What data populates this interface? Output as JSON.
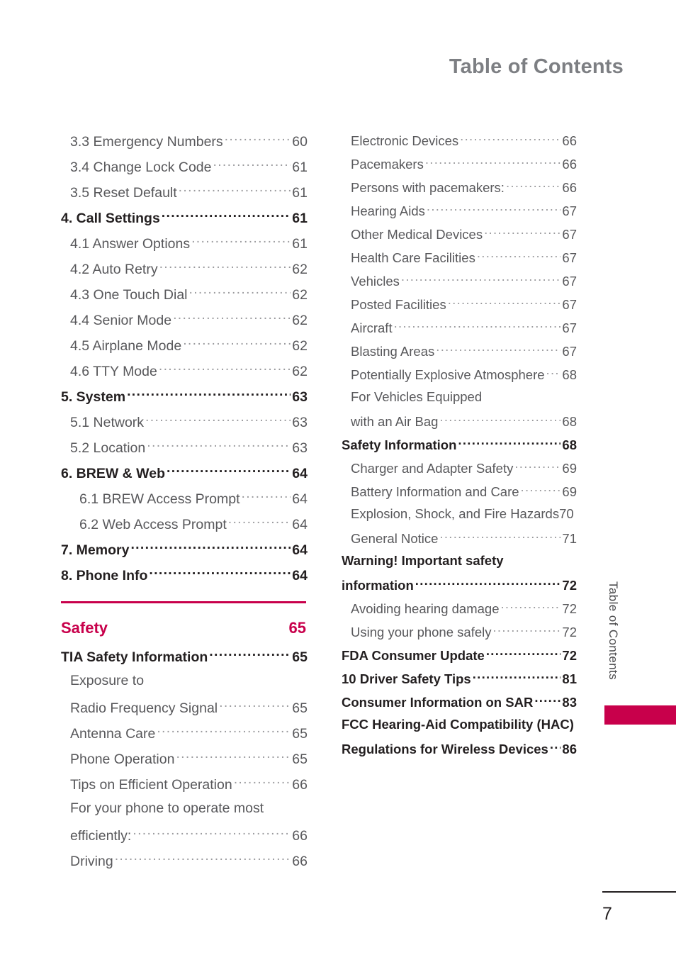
{
  "header": {
    "title": "Table of Contents"
  },
  "side_tab": {
    "label": "Table of Contents",
    "marker_color": "#c8004b"
  },
  "footer": {
    "page_number": "7"
  },
  "theme": {
    "accent": "#c8004b",
    "heading_gray": "#7d7f83",
    "body_gray": "#58585b",
    "bold_black": "#231f20"
  },
  "columns": {
    "left": {
      "rows": [
        {
          "title": "3.3 Emergency Numbers",
          "page": "60",
          "level": 2
        },
        {
          "title": "3.4 Change Lock Code",
          "page": "61",
          "level": 2
        },
        {
          "title": "3.5 Reset Default",
          "page": "61",
          "level": 2
        },
        {
          "title": "4. Call Settings",
          "page": "61",
          "level": 1
        },
        {
          "title": "4.1 Answer Options",
          "page": "61",
          "level": 2
        },
        {
          "title": "4.2 Auto Retry",
          "page": "62",
          "level": 2
        },
        {
          "title": "4.3 One Touch Dial",
          "page": "62",
          "level": 2
        },
        {
          "title": "4.4 Senior Mode",
          "page": "62",
          "level": 2
        },
        {
          "title": "4.5 Airplane Mode",
          "page": "62",
          "level": 2
        },
        {
          "title": "4.6 TTY Mode",
          "page": "62",
          "level": 2
        },
        {
          "title": "5. System",
          "page": "63",
          "level": 1
        },
        {
          "title": "5.1 Network",
          "page": "63",
          "level": 2
        },
        {
          "title": "5.2 Location",
          "page": "63",
          "level": 2
        },
        {
          "title": "6. BREW & Web",
          "page": "64",
          "level": 1
        },
        {
          "title": "6.1 BREW Access Prompt",
          "page": "64",
          "level": 3
        },
        {
          "title": "6.2 Web Access Prompt",
          "page": "64",
          "level": 3
        },
        {
          "title": "7. Memory",
          "page": "64",
          "level": 1
        },
        {
          "title": "8. Phone Info",
          "page": "64",
          "level": 1
        }
      ],
      "section": {
        "title": "Safety",
        "page": "65"
      },
      "rows_after_section": [
        {
          "title": "TIA Safety Information",
          "page": "65",
          "level": 1
        },
        {
          "title": "Exposure to",
          "page": "",
          "level": 2,
          "no_page": true
        },
        {
          "title": "Radio Frequency Signal",
          "page": "65",
          "level": 2
        },
        {
          "title": "Antenna Care",
          "page": "65",
          "level": 2
        },
        {
          "title": "Phone Operation",
          "page": "65",
          "level": 2
        },
        {
          "title": "Tips on Efficient Operation",
          "page": "66",
          "level": 2
        },
        {
          "title": "For your phone to operate most",
          "page": "",
          "level": 2,
          "no_page": true
        },
        {
          "title": "efficiently:",
          "page": "66",
          "level": 2
        },
        {
          "title": "Driving",
          "page": "66",
          "level": 2
        }
      ]
    },
    "right": {
      "rows": [
        {
          "title": "Electronic Devices",
          "page": "66",
          "level": 2
        },
        {
          "title": "Pacemakers",
          "page": "66",
          "level": 2
        },
        {
          "title": "Persons with pacemakers:",
          "page": "66",
          "level": 2
        },
        {
          "title": "Hearing Aids",
          "page": "67",
          "level": 2
        },
        {
          "title": "Other Medical Devices",
          "page": "67",
          "level": 2
        },
        {
          "title": "Health Care Facilities",
          "page": "67",
          "level": 2
        },
        {
          "title": "Vehicles",
          "page": "67",
          "level": 2
        },
        {
          "title": "Posted Facilities",
          "page": "67",
          "level": 2
        },
        {
          "title": "Aircraft",
          "page": "67",
          "level": 2
        },
        {
          "title": "Blasting Areas",
          "page": "67",
          "level": 2
        },
        {
          "title": "Potentially Explosive Atmosphere",
          "page": "68",
          "level": 2,
          "short_leader": true
        },
        {
          "title": "For Vehicles Equipped",
          "page": "",
          "level": 2,
          "no_page": true
        },
        {
          "title": "with an Air Bag",
          "page": "68",
          "level": 2
        },
        {
          "title": "Safety Information",
          "page": "68",
          "level": 1
        },
        {
          "title": "Charger and Adapter Safety",
          "page": "69",
          "level": 2
        },
        {
          "title": "Battery Information and Care",
          "page": "69",
          "level": 2
        },
        {
          "title": "Explosion, Shock, and Fire Hazards",
          "page": "70",
          "level": 2,
          "no_leader": true
        },
        {
          "title": "General Notice",
          "page": "71",
          "level": 2
        },
        {
          "title": "Warning! Important safety",
          "page": "",
          "level": 1,
          "no_page": true
        },
        {
          "title": "information",
          "page": "72",
          "level": 1
        },
        {
          "title": "Avoiding hearing damage",
          "page": "72",
          "level": 2
        },
        {
          "title": "Using your phone safely",
          "page": "72",
          "level": 2
        },
        {
          "title": "FDA Consumer Update",
          "page": "72",
          "level": 1
        },
        {
          "title": "10 Driver Safety Tips",
          "page": "81",
          "level": 1
        },
        {
          "title": "Consumer Information on SAR",
          "page": "83",
          "level": 1
        },
        {
          "title": "FCC Hearing-Aid Compatibility (HAC)",
          "page": "",
          "level": 1,
          "no_page": true,
          "no_leader": true
        },
        {
          "title": "Regulations for Wireless Devices",
          "page": "86",
          "level": 1
        }
      ]
    }
  }
}
